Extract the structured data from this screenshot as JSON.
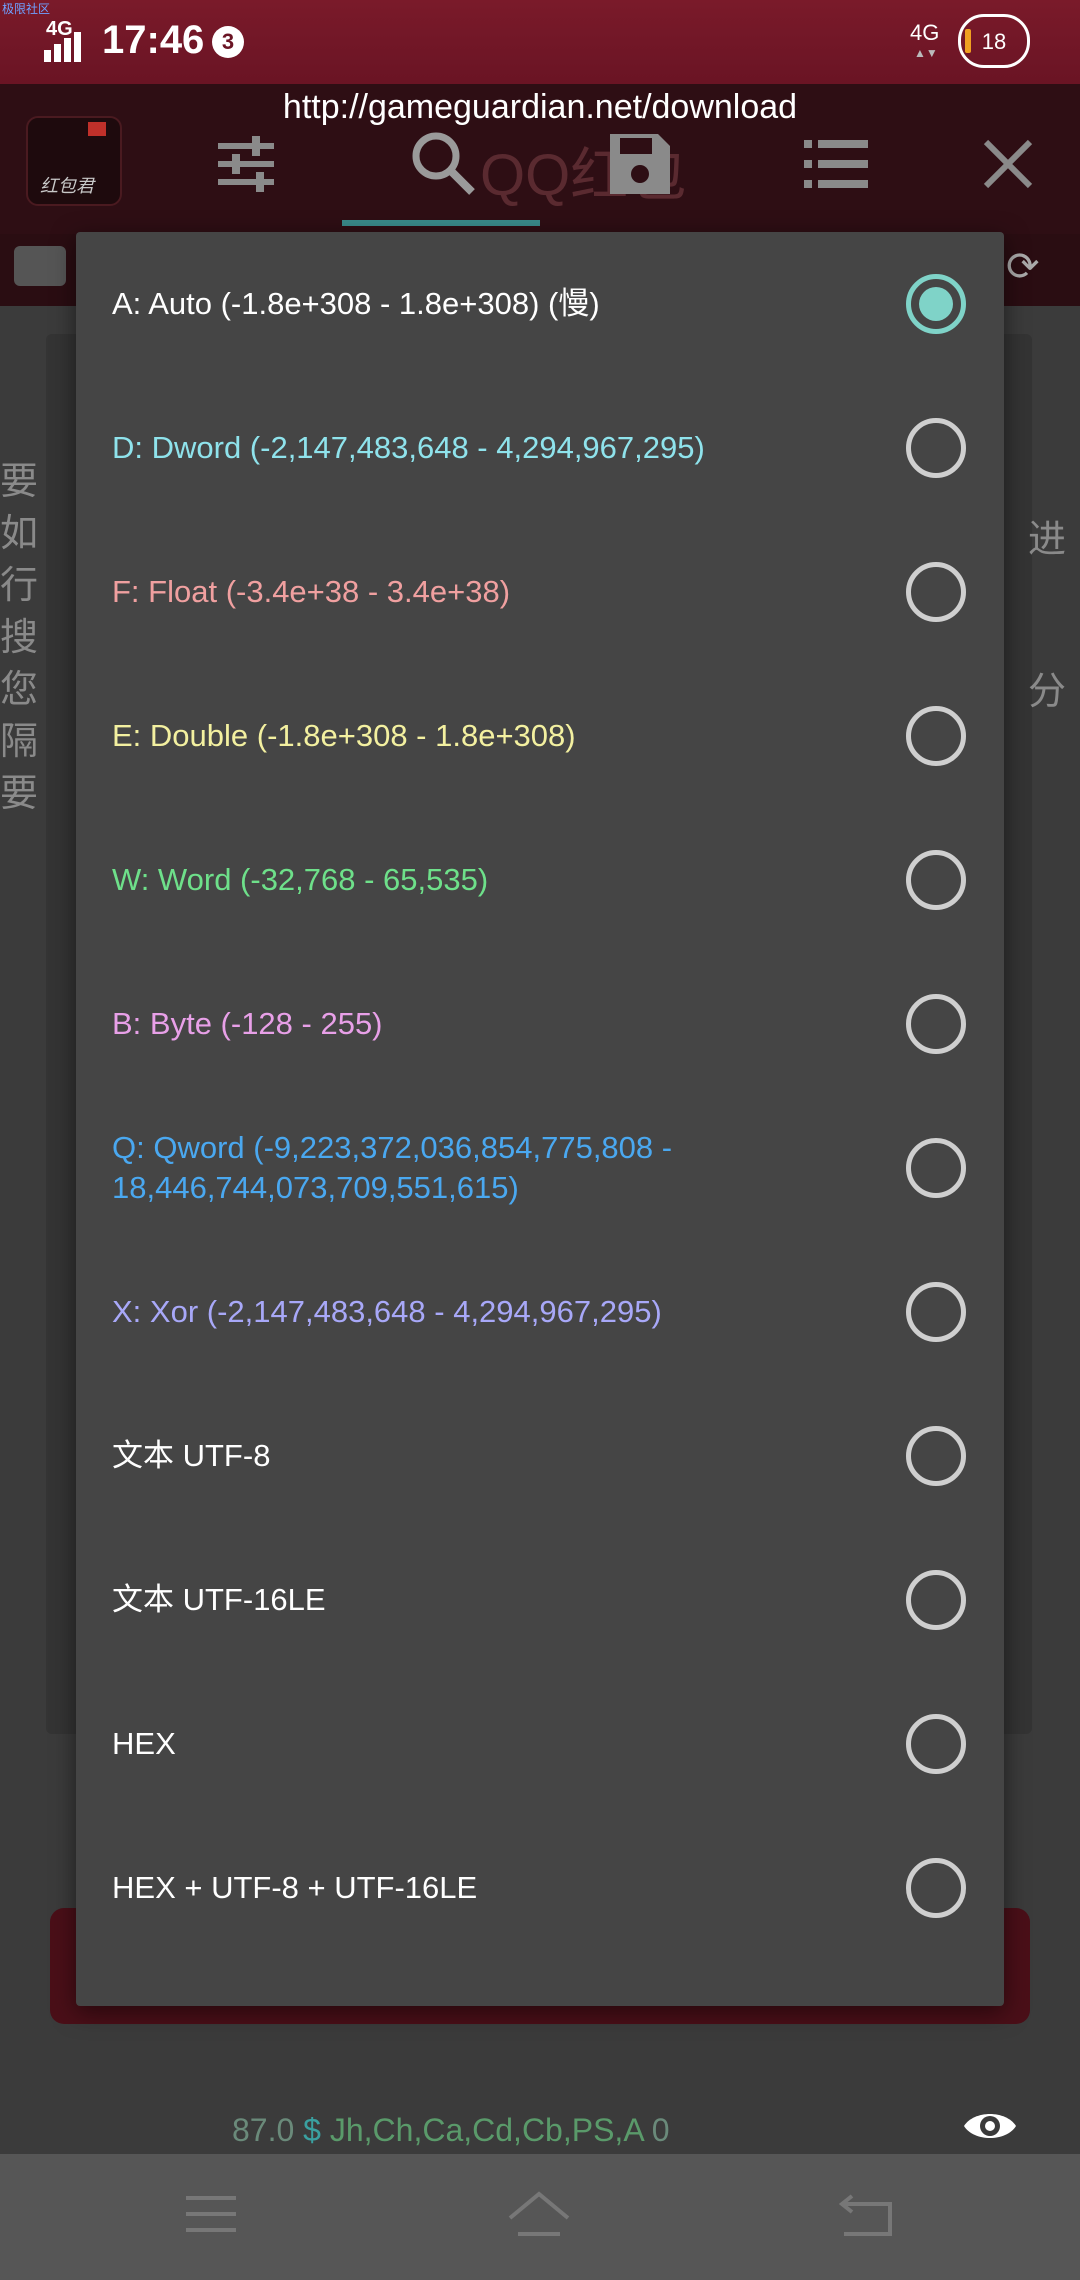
{
  "status_bar": {
    "watermark": "极限社区",
    "network_left": "4G",
    "time": "17:46",
    "notification_count": "3",
    "network_right": "4G",
    "battery": "18"
  },
  "toolbar": {
    "url": "http://gameguardian.net/download",
    "search_text": "QQ红包",
    "logo_text": "红包君"
  },
  "background": {
    "left_column": "要如行搜您隔要",
    "right_top": "进",
    "right_mid": "分",
    "footer_number": "87.0",
    "footer_dollar": "$",
    "footer_registers": "Jh,Ch,Ca,Cd,Cb,PS,A",
    "footer_zero": "0"
  },
  "dialog": {
    "selected_index": 0,
    "options": [
      {
        "label": "A: Auto (-1.8e+308 - 1.8e+308) (慢)",
        "color": "#ffffff"
      },
      {
        "label": "D: Dword (-2,147,483,648 - 4,294,967,295)",
        "color": "#8fe3ec"
      },
      {
        "label": "F: Float (-3.4e+38 - 3.4e+38)",
        "color": "#f0a0a0"
      },
      {
        "label": "E: Double (-1.8e+308 - 1.8e+308)",
        "color": "#f3f0a0"
      },
      {
        "label": "W: Word (-32,768 - 65,535)",
        "color": "#6ee08a"
      },
      {
        "label": "B: Byte (-128 - 255)",
        "color": "#e8a0e8"
      },
      {
        "label": "Q: Qword (-9,223,372,036,854,775,808 - 18,446,744,073,709,551,615)",
        "color": "#4aa8f0"
      },
      {
        "label": "X: Xor (-2,147,483,648 - 4,294,967,295)",
        "color": "#a8a8f8"
      },
      {
        "label": "文本 UTF-8",
        "color": "#ffffff"
      },
      {
        "label": "文本 UTF-16LE",
        "color": "#ffffff"
      },
      {
        "label": "HEX",
        "color": "#ffffff"
      },
      {
        "label": "HEX + UTF-8 + UTF-16LE",
        "color": "#ffffff"
      }
    ]
  }
}
